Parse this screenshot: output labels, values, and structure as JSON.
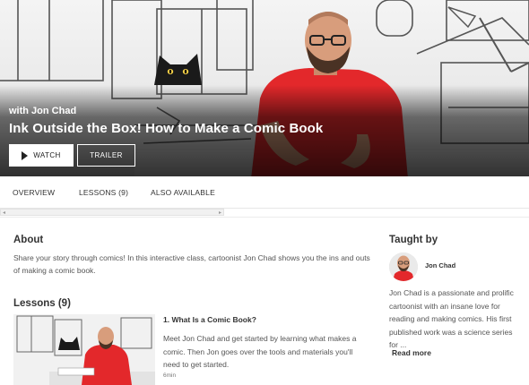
{
  "hero": {
    "instructor_line": "with Jon Chad",
    "title": "Ink Outside the Box! How to Make a Comic Book",
    "watch_label": "WATCH",
    "trailer_label": "TRAILER"
  },
  "tabs": [
    {
      "label": "OVERVIEW"
    },
    {
      "label": "LESSONS (9)"
    },
    {
      "label": "ALSO AVAILABLE"
    }
  ],
  "about": {
    "heading": "About",
    "text": "Share your story through comics! In this interactive class, cartoonist Jon Chad shows you the ins and outs of making a comic book."
  },
  "lessons": {
    "heading": "Lessons (9)",
    "items": [
      {
        "title": "1. What Is a Comic Book?",
        "description": "Meet Jon Chad and get started by learning what makes a comic. Then Jon goes over the tools and materials you'll need to get started.",
        "duration": "6min"
      }
    ]
  },
  "sidebar": {
    "heading": "Taught by",
    "teacher_name": "Jon Chad",
    "bio": "Jon Chad is a passionate and prolific cartoonist with an insane love for reading and making comics. His first published work was a science series for ...",
    "read_more": "Read more"
  },
  "icons": {
    "play": "play-icon",
    "scroll_left": "chevron-left-icon",
    "scroll_right": "chevron-right-icon"
  },
  "colors": {
    "shirt_red": "#e3282b",
    "text_dark": "#333333",
    "overlay_black": "#000000"
  }
}
